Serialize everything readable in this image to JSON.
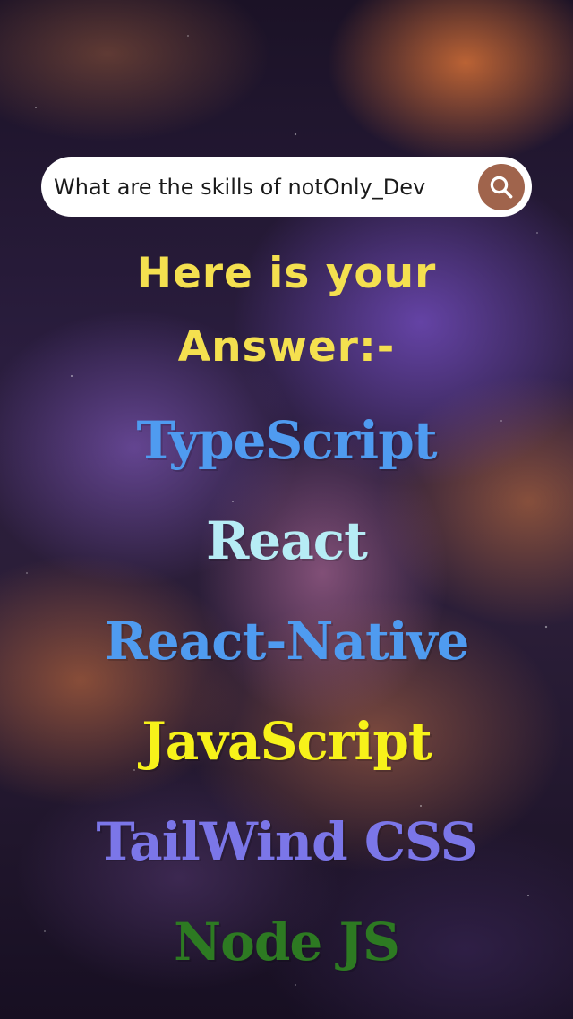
{
  "search": {
    "query": "What are the skills of notOnly_Dev",
    "icon": "search-icon",
    "button_color": "#a0644c"
  },
  "answer": {
    "line1": "Here is your",
    "line2": "Answer:-",
    "color": "#f4e04f"
  },
  "skills": [
    {
      "label": "TypeScript",
      "color": "#4f9bf0"
    },
    {
      "label": "React",
      "color": "#b6ecf5"
    },
    {
      "label": "React-Native",
      "color": "#4f9bf0"
    },
    {
      "label": "JavaScript",
      "color": "#f7f21a"
    },
    {
      "label": "TailWind CSS",
      "color": "#7b76e8"
    },
    {
      "label": "Node JS",
      "color": "#2d7a22"
    }
  ]
}
